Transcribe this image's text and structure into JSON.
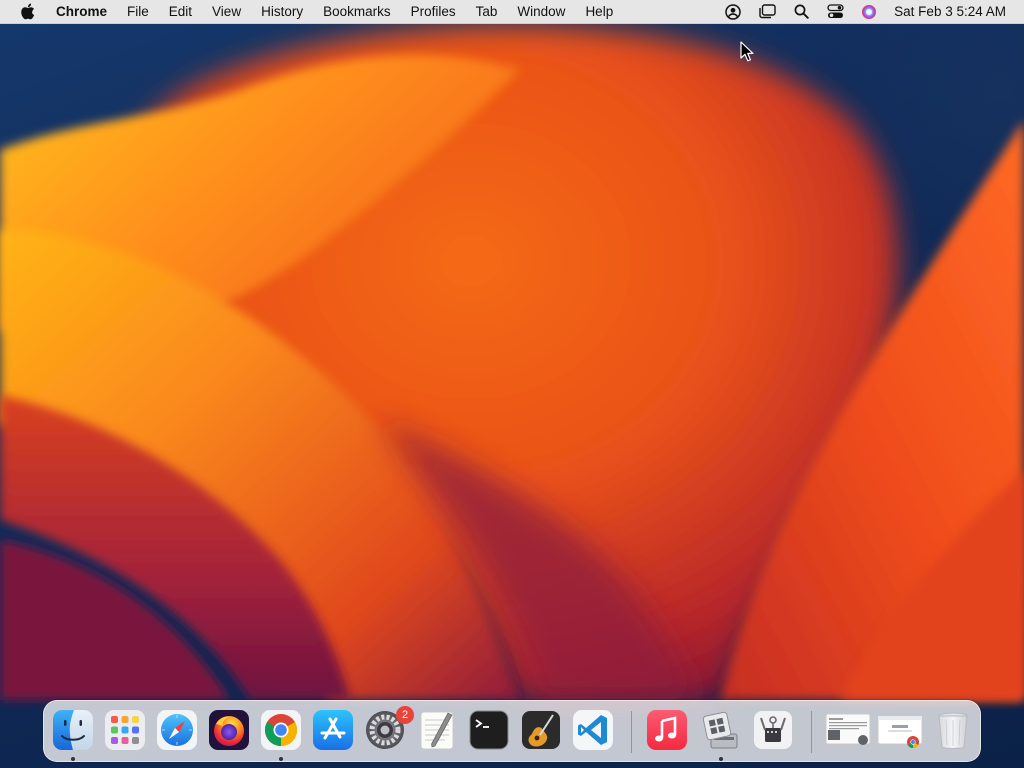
{
  "menubar": {
    "app_name": "Chrome",
    "menus": [
      "File",
      "Edit",
      "View",
      "History",
      "Bookmarks",
      "Profiles",
      "Tab",
      "Window",
      "Help"
    ],
    "status_icons": [
      "user-account-icon",
      "stage-manager-icon",
      "spotlight-search-icon",
      "control-center-icon",
      "siri-icon"
    ],
    "clock": "Sat Feb 3  5:24 AM"
  },
  "dock": {
    "apps": [
      {
        "name": "Finder",
        "icon": "finder-icon",
        "running": true
      },
      {
        "name": "Launchpad",
        "icon": "launchpad-icon",
        "running": false
      },
      {
        "name": "Safari",
        "icon": "safari-icon",
        "running": false
      },
      {
        "name": "Firefox",
        "icon": "firefox-icon",
        "running": false
      },
      {
        "name": "Google Chrome",
        "icon": "chrome-icon",
        "running": true
      },
      {
        "name": "App Store",
        "icon": "app-store-icon",
        "running": false
      },
      {
        "name": "System Settings",
        "icon": "system-settings-icon",
        "running": false,
        "badge": "2"
      },
      {
        "name": "TextEdit",
        "icon": "textedit-icon",
        "running": false
      },
      {
        "name": "Terminal",
        "icon": "terminal-icon",
        "running": false
      },
      {
        "name": "GarageBand",
        "icon": "garageband-icon",
        "running": false
      },
      {
        "name": "Visual Studio Code",
        "icon": "vscode-icon",
        "running": false
      },
      {
        "name": "Music",
        "icon": "music-icon",
        "running": false
      },
      {
        "name": "Boot Camp Assistant",
        "icon": "bootcamp-icon",
        "running": true
      },
      {
        "name": "System Information",
        "icon": "system-information-icon",
        "running": false
      }
    ],
    "recent_items": [
      {
        "name": "Downloads stack",
        "icon": "downloads-stack-icon"
      },
      {
        "name": "Chrome document",
        "icon": "chrome-document-icon"
      }
    ],
    "trash": {
      "name": "Trash",
      "icon": "trash-icon"
    }
  },
  "colors": {
    "wallpaper_orange": "#f2651b",
    "wallpaper_yellow": "#ffb30f",
    "wallpaper_magenta": "#8a1c3e",
    "wallpaper_blue": "#0f2a55",
    "badge_red": "#e8443a"
  }
}
